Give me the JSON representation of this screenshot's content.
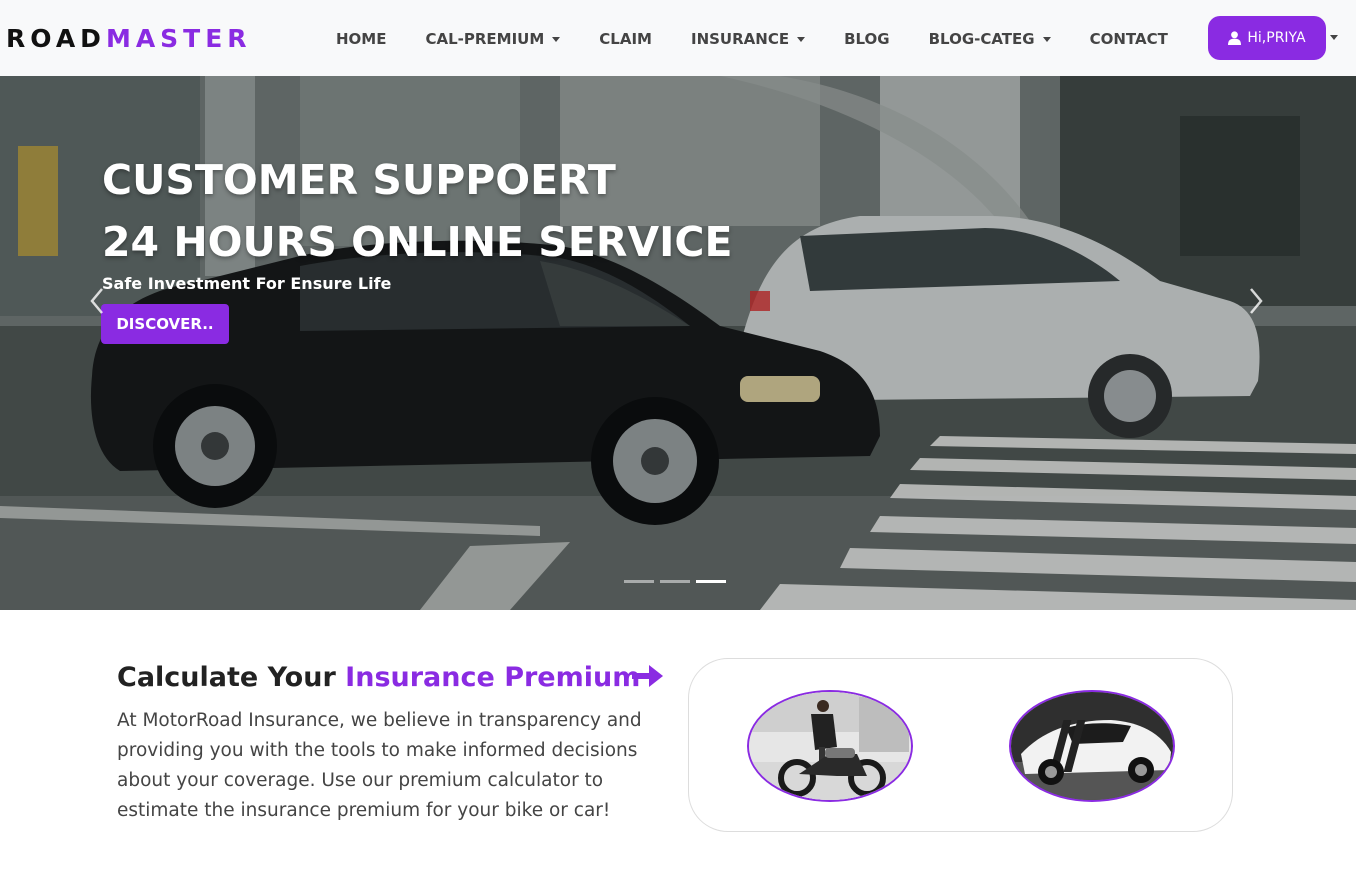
{
  "brand": {
    "part1": "ROAD",
    "part2": "MASTER"
  },
  "nav": {
    "items": [
      {
        "label": "HOME",
        "dropdown": false
      },
      {
        "label": "CAL-PREMIUM",
        "dropdown": true
      },
      {
        "label": "CLAIM",
        "dropdown": false
      },
      {
        "label": "INSURANCE",
        "dropdown": true
      },
      {
        "label": "BLOG",
        "dropdown": false
      },
      {
        "label": "BLOG-CATEG",
        "dropdown": true
      },
      {
        "label": "CONTACT",
        "dropdown": false
      }
    ],
    "user_label": "Hi,PRIYA",
    "user_icon": "user-icon"
  },
  "hero": {
    "title_line1": "CUSTOMER SUPPOERT",
    "title_line2": "24 HOURS ONLINE SERVICE",
    "subtitle": "Safe Investment For Ensure Life",
    "button": "DISCOVER..",
    "slides": 3,
    "active_slide": 3
  },
  "calc": {
    "title_plain": "Calculate Your ",
    "title_highlight": "Insurance Premium",
    "description": "At MotorRoad Insurance, we believe in transparency and providing you with the tools to make informed decisions about your coverage. Use our premium calculator to estimate the insurance premium for your bike or car!",
    "options": [
      "bike",
      "car"
    ]
  },
  "colors": {
    "accent": "#8a2be2",
    "nav_bg": "#f8f9fa",
    "text": "#444444"
  }
}
